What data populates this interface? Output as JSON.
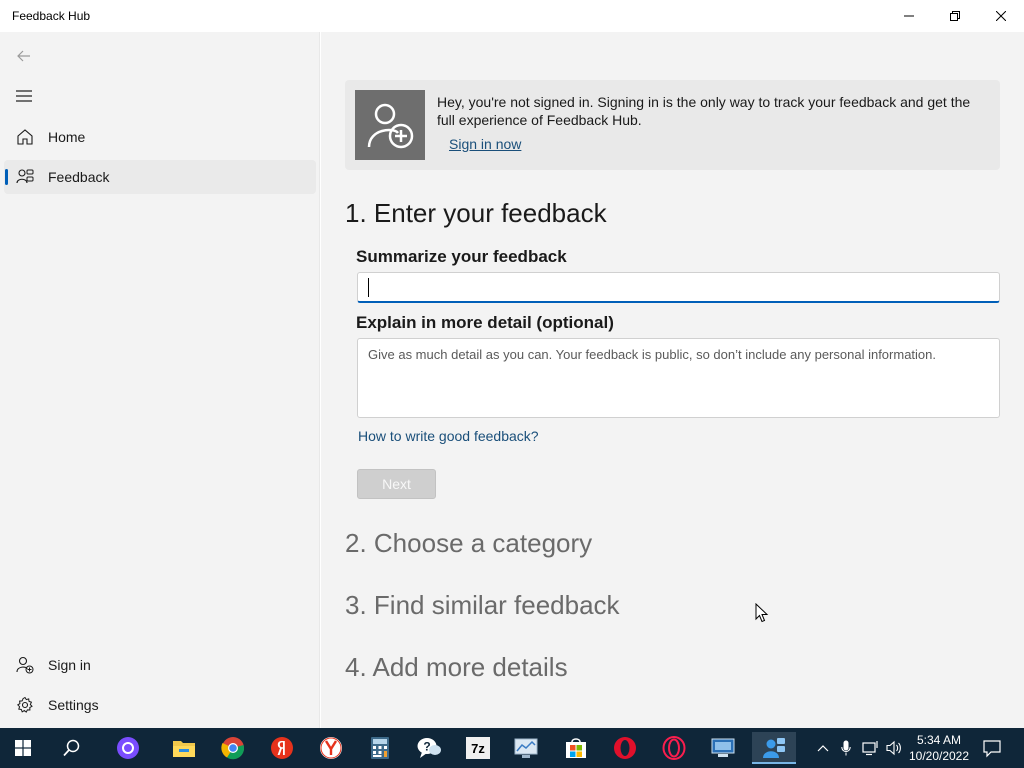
{
  "window": {
    "title": "Feedback Hub",
    "controls": {
      "minimize": "minimize-icon",
      "maximize": "restore-icon",
      "close": "close-icon"
    }
  },
  "sidebar": {
    "items": [
      {
        "label": "Home",
        "icon": "home-icon",
        "selected": false
      },
      {
        "label": "Feedback",
        "icon": "feedback-icon",
        "selected": true
      }
    ],
    "footer": [
      {
        "label": "Sign in",
        "icon": "person-add-icon"
      },
      {
        "label": "Settings",
        "icon": "gear-icon"
      }
    ]
  },
  "banner": {
    "text": "Hey, you're not signed in. Signing in is the only way to track your feedback and get the full experience of Feedback Hub.",
    "link": "Sign in now"
  },
  "form": {
    "step1_title": "1. Enter your feedback",
    "summary_label": "Summarize your feedback",
    "summary_value": "",
    "detail_label": "Explain in more detail (optional)",
    "detail_placeholder": "Give as much detail as you can. Your feedback is public, so don’t include any personal information.",
    "howto_link": "How to write good feedback?",
    "next_label": "Next",
    "step2_title": "2. Choose a category",
    "step3_title": "3. Find similar feedback",
    "step4_title": "4. Add more details"
  },
  "taskbar": {
    "apps": [
      "windows-start-icon",
      "search-icon",
      "alice-icon",
      "file-explorer-icon",
      "chrome-icon",
      "yandex-icon",
      "yandex-browser-icon",
      "calculator-icon",
      "feedback-chat-icon",
      "7zip-icon",
      "control-panel-icon",
      "store-icon",
      "opera-icon",
      "opera-gx-icon",
      "network-manager-icon",
      "feedback-hub-icon"
    ],
    "clock_time": "5:34 AM",
    "clock_date": "10/20/2022"
  },
  "colors": {
    "accent": "#005fb8",
    "link": "#1a4f7a",
    "taskbar": "#0f2639"
  }
}
